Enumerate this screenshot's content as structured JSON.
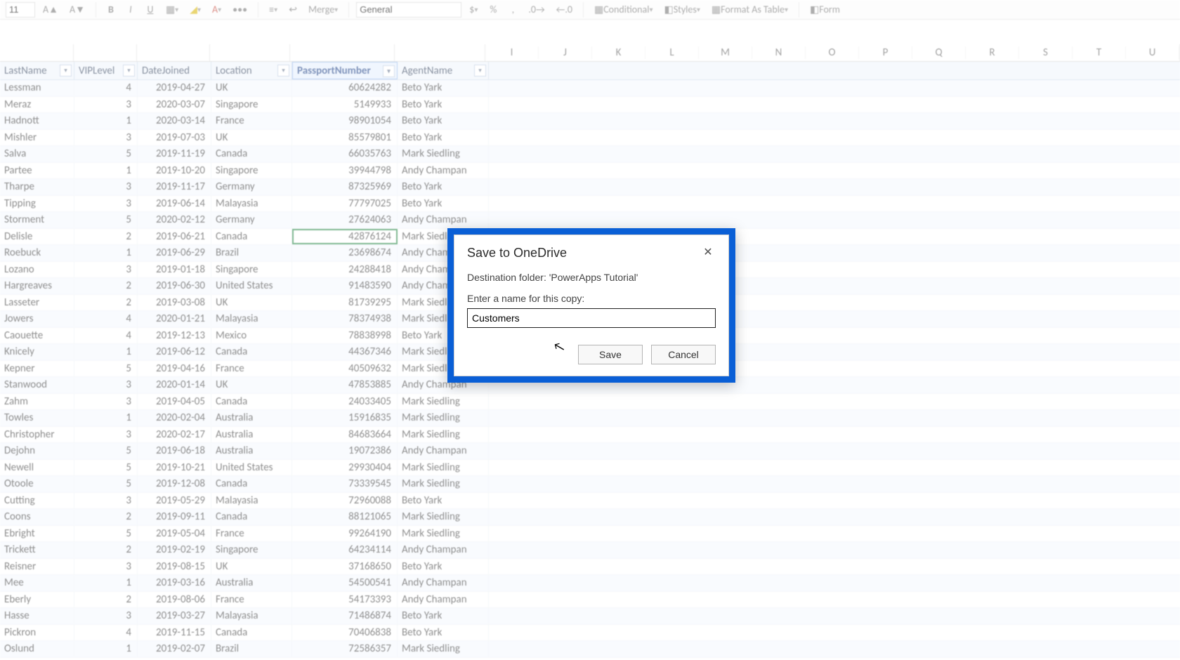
{
  "ribbon": {
    "font_size": "11",
    "merge_label": "Merge",
    "num_format": "General",
    "conditional_label": "Conditional",
    "styles_label": "Styles",
    "format_table_label": "Format As Table",
    "form_label": "Form"
  },
  "col_letters": [
    "I",
    "J",
    "K",
    "L",
    "M",
    "N",
    "O",
    "P",
    "Q",
    "R",
    "S",
    "T",
    "U"
  ],
  "table": {
    "headers": {
      "lastName": "LastName",
      "vipLevel": "VIPLevel",
      "dateJoined": "DateJoined",
      "location": "Location",
      "passport": "PassportNumber",
      "agent": "AgentName"
    },
    "active_cell": {
      "row": 9,
      "col": "passport"
    },
    "rows": [
      {
        "lastName": "Lessman",
        "vip": 4,
        "date": "2019-04-27",
        "loc": "UK",
        "passport": "60624282",
        "agent": "Beto Yark"
      },
      {
        "lastName": "Meraz",
        "vip": 3,
        "date": "2020-03-07",
        "loc": "Singapore",
        "passport": "5149933",
        "agent": "Beto Yark"
      },
      {
        "lastName": "Hadnott",
        "vip": 1,
        "date": "2020-03-14",
        "loc": "France",
        "passport": "98901054",
        "agent": "Beto Yark"
      },
      {
        "lastName": "Mishler",
        "vip": 3,
        "date": "2019-07-03",
        "loc": "UK",
        "passport": "85579801",
        "agent": "Beto Yark"
      },
      {
        "lastName": "Salva",
        "vip": 5,
        "date": "2019-11-19",
        "loc": "Canada",
        "passport": "66035763",
        "agent": "Mark Siedling"
      },
      {
        "lastName": "Partee",
        "vip": 1,
        "date": "2019-10-20",
        "loc": "Singapore",
        "passport": "39944798",
        "agent": "Andy Champan"
      },
      {
        "lastName": "Tharpe",
        "vip": 3,
        "date": "2019-11-17",
        "loc": "Germany",
        "passport": "87325969",
        "agent": "Beto Yark"
      },
      {
        "lastName": "Tipping",
        "vip": 3,
        "date": "2019-06-14",
        "loc": "Malayasia",
        "passport": "77797025",
        "agent": "Beto Yark"
      },
      {
        "lastName": "Storment",
        "vip": 5,
        "date": "2020-02-12",
        "loc": "Germany",
        "passport": "27624063",
        "agent": "Andy Champan"
      },
      {
        "lastName": "Delisle",
        "vip": 2,
        "date": "2019-06-21",
        "loc": "Canada",
        "passport": "42876124",
        "agent": "Mark Siedling"
      },
      {
        "lastName": "Roebuck",
        "vip": 1,
        "date": "2019-06-29",
        "loc": "Brazil",
        "passport": "23698674",
        "agent": "Andy Champan"
      },
      {
        "lastName": "Lozano",
        "vip": 3,
        "date": "2019-01-18",
        "loc": "Singapore",
        "passport": "24288418",
        "agent": "Andy Champan"
      },
      {
        "lastName": "Hargreaves",
        "vip": 2,
        "date": "2019-06-30",
        "loc": "United States",
        "passport": "91483590",
        "agent": "Andy Champan"
      },
      {
        "lastName": "Lasseter",
        "vip": 2,
        "date": "2019-03-08",
        "loc": "UK",
        "passport": "81739295",
        "agent": "Mark Siedling"
      },
      {
        "lastName": "Jowers",
        "vip": 4,
        "date": "2020-01-21",
        "loc": "Malayasia",
        "passport": "78374938",
        "agent": "Mark Siedling"
      },
      {
        "lastName": "Caouette",
        "vip": 4,
        "date": "2019-12-13",
        "loc": "Mexico",
        "passport": "78838998",
        "agent": "Beto Yark"
      },
      {
        "lastName": "Knicely",
        "vip": 1,
        "date": "2019-06-12",
        "loc": "Canada",
        "passport": "44367346",
        "agent": "Mark Siedling"
      },
      {
        "lastName": "Kepner",
        "vip": 5,
        "date": "2019-04-16",
        "loc": "France",
        "passport": "40509632",
        "agent": "Mark Siedling"
      },
      {
        "lastName": "Stanwood",
        "vip": 3,
        "date": "2020-01-14",
        "loc": "UK",
        "passport": "47853885",
        "agent": "Andy Champan"
      },
      {
        "lastName": "Zahm",
        "vip": 3,
        "date": "2019-04-05",
        "loc": "Canada",
        "passport": "24033405",
        "agent": "Mark Siedling"
      },
      {
        "lastName": "Towles",
        "vip": 1,
        "date": "2020-02-04",
        "loc": "Australia",
        "passport": "15916835",
        "agent": "Mark Siedling"
      },
      {
        "lastName": "Christopher",
        "vip": 3,
        "date": "2020-02-17",
        "loc": "Australia",
        "passport": "84683664",
        "agent": "Mark Siedling"
      },
      {
        "lastName": "Dejohn",
        "vip": 5,
        "date": "2019-06-18",
        "loc": "Australia",
        "passport": "19072386",
        "agent": "Andy Champan"
      },
      {
        "lastName": "Newell",
        "vip": 5,
        "date": "2019-10-21",
        "loc": "United States",
        "passport": "29930404",
        "agent": "Mark Siedling"
      },
      {
        "lastName": "Otoole",
        "vip": 5,
        "date": "2019-12-08",
        "loc": "Canada",
        "passport": "73339545",
        "agent": "Mark Siedling"
      },
      {
        "lastName": "Cutting",
        "vip": 3,
        "date": "2019-05-29",
        "loc": "Malayasia",
        "passport": "72960088",
        "agent": "Beto Yark"
      },
      {
        "lastName": "Coons",
        "vip": 2,
        "date": "2019-09-11",
        "loc": "Canada",
        "passport": "88121065",
        "agent": "Mark Siedling"
      },
      {
        "lastName": "Ebright",
        "vip": 5,
        "date": "2019-05-04",
        "loc": "France",
        "passport": "99264190",
        "agent": "Mark Siedling"
      },
      {
        "lastName": "Trickett",
        "vip": 2,
        "date": "2019-02-19",
        "loc": "Singapore",
        "passport": "64234114",
        "agent": "Andy Champan"
      },
      {
        "lastName": "Reisner",
        "vip": 3,
        "date": "2019-08-15",
        "loc": "UK",
        "passport": "37168650",
        "agent": "Beto Yark"
      },
      {
        "lastName": "Mee",
        "vip": 1,
        "date": "2019-03-16",
        "loc": "Australia",
        "passport": "54500541",
        "agent": "Andy Champan"
      },
      {
        "lastName": "Eberly",
        "vip": 2,
        "date": "2019-08-06",
        "loc": "France",
        "passport": "54173393",
        "agent": "Andy Champan"
      },
      {
        "lastName": "Hasse",
        "vip": 3,
        "date": "2019-03-27",
        "loc": "Malayasia",
        "passport": "71486874",
        "agent": "Beto Yark"
      },
      {
        "lastName": "Pickron",
        "vip": 4,
        "date": "2019-11-15",
        "loc": "Canada",
        "passport": "70406838",
        "agent": "Beto Yark"
      },
      {
        "lastName": "Oslund",
        "vip": 1,
        "date": "2019-02-07",
        "loc": "Brazil",
        "passport": "72586357",
        "agent": "Mark Siedling"
      }
    ]
  },
  "dialog": {
    "title": "Save to OneDrive",
    "destination": "Destination folder: 'PowerApps Tutorial'",
    "prompt": "Enter a name for this copy:",
    "input_value": "Customers",
    "save_label": "Save",
    "cancel_label": "Cancel",
    "close_glyph": "✕"
  }
}
